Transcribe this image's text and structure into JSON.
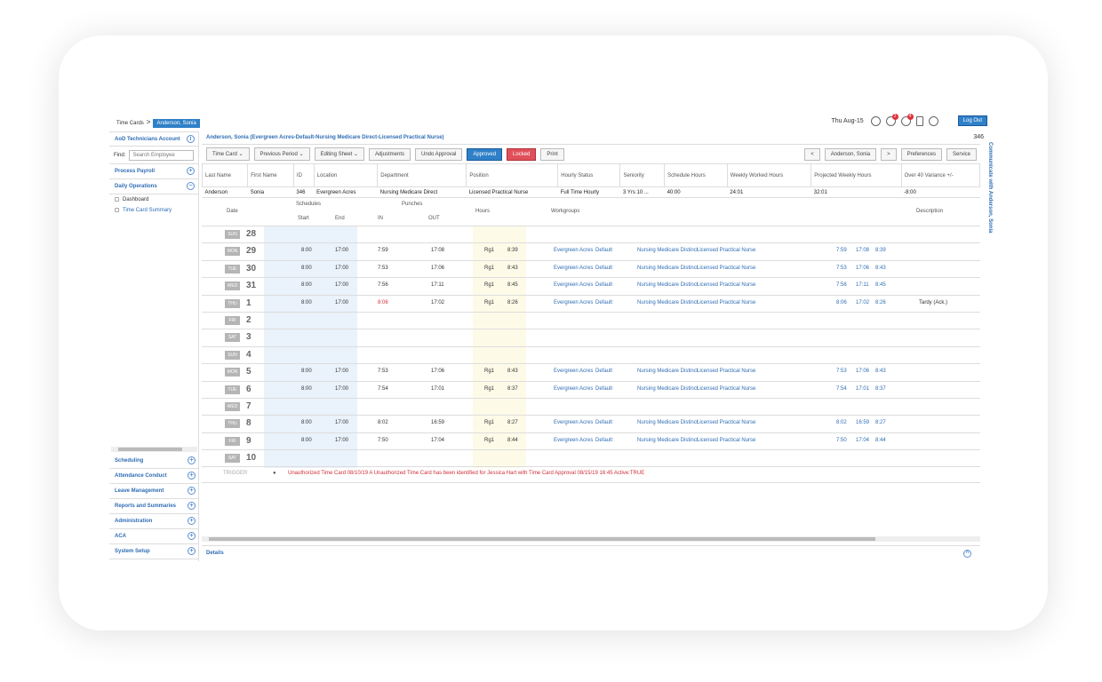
{
  "breadcrumb": {
    "root": "Time Cards",
    "sep": ">",
    "current": "Anderson, Sonia"
  },
  "topbar": {
    "date": "Thu Aug-15",
    "notif_badge1": "2",
    "notif_badge2": "4",
    "logout": "Log Out"
  },
  "sidebar": {
    "account": "AoD Technicians Account",
    "find_label": "Find:",
    "find_placeholder": "Search Employee",
    "sections": [
      "Process Payroll",
      "Daily Operations"
    ],
    "items": [
      "Dashboard",
      "Time Card Summary"
    ],
    "lower": [
      "Scheduling",
      "Attendance Conduct",
      "Leave Management",
      "Reports and Summaries",
      "Administration",
      "ACA",
      "System Setup"
    ]
  },
  "main": {
    "title": "Anderson, Sonia (Evergreen Acres-Default-Nursing Medicare Direct-Licensed Practical Nurse)",
    "count": "346",
    "toolbar": [
      "Time Card",
      "Previous Period",
      "Editing Sheet",
      "Adjustments",
      "Undo Approval",
      "Approved",
      "Locked",
      "Print"
    ],
    "toolbar_right": [
      "<",
      "Anderson, Sonia",
      ">",
      "Preferences",
      "Service"
    ],
    "info_headers": [
      "Last Name",
      "First Name",
      "ID",
      "Location",
      "Department",
      "Position",
      "Hourly Status",
      "Seniority",
      "Schedule Hours",
      "Weekly Worked Hours",
      "Projected Weekly Hours",
      "Over 40 Variance +/-"
    ],
    "info_values": [
      "Anderson",
      "Sonia",
      "346",
      "Evergreen Acres",
      "Nursing Medicare Direct",
      "Licensed Practical Nurse",
      "Full Time Hourly",
      "3 Yrs 10 ...",
      "40:00",
      "24:01",
      "32:01",
      "-8:00"
    ],
    "grid_headers": {
      "date": "Date",
      "schedules": "Schedules",
      "start": "Start",
      "end": "End",
      "punches": "Punches",
      "in": "IN",
      "out": "OUT",
      "hours": "Hours",
      "workgroups": "Workgroups",
      "description": "Description"
    },
    "rows": [
      {
        "day": "SUN",
        "num": "28"
      },
      {
        "day": "MON",
        "num": "29",
        "start": "8:00",
        "end": "17:00",
        "in": "7:59",
        "out": "17:08",
        "code": "Rg1",
        "hours": "8:39",
        "loc": "Evergreen Acres",
        "grp": "Default",
        "dept": "Nursing Medicare Distinct",
        "pos": "Licensed Practical Nurse",
        "p1": "7:59",
        "p2": "17:08",
        "p3": "8:39"
      },
      {
        "day": "TUE",
        "num": "30",
        "start": "8:00",
        "end": "17:00",
        "in": "7:53",
        "out": "17:06",
        "code": "Rg1",
        "hours": "8:43",
        "loc": "Evergreen Acres",
        "grp": "Default",
        "dept": "Nursing Medicare Distinct",
        "pos": "Licensed Practical Nurse",
        "p1": "7:53",
        "p2": "17:06",
        "p3": "8:43"
      },
      {
        "day": "WED",
        "num": "31",
        "start": "8:00",
        "end": "17:00",
        "in": "7:56",
        "out": "17:11",
        "code": "Rg1",
        "hours": "8:45",
        "loc": "Evergreen Acres",
        "grp": "Default",
        "dept": "Nursing Medicare Distinct",
        "pos": "Licensed Practical Nurse",
        "p1": "7:56",
        "p2": "17:11",
        "p3": "8:45"
      },
      {
        "day": "THU",
        "num": "1",
        "start": "8:00",
        "end": "17:00",
        "in": "8:06",
        "out": "17:02",
        "code": "Rg1",
        "hours": "8:26",
        "loc": "Evergreen Acres",
        "grp": "Default",
        "dept": "Nursing Medicare Distinct",
        "pos": "Licensed Practical Nurse",
        "p1": "8:06",
        "p2": "17:02",
        "p3": "8:26",
        "desc": "Tardy (Ack.)"
      },
      {
        "day": "FRI",
        "num": "2"
      },
      {
        "day": "SAT",
        "num": "3"
      },
      {
        "day": "SUN",
        "num": "4"
      },
      {
        "day": "MON",
        "num": "5",
        "start": "8:00",
        "end": "17:00",
        "in": "7:53",
        "out": "17:06",
        "code": "Rg1",
        "hours": "8:43",
        "loc": "Evergreen Acres",
        "grp": "Default",
        "dept": "Nursing Medicare Distinct",
        "pos": "Licensed Practical Nurse",
        "p1": "7:53",
        "p2": "17:06",
        "p3": "8:43"
      },
      {
        "day": "TUE",
        "num": "6",
        "start": "8:00",
        "end": "17:00",
        "in": "7:54",
        "out": "17:01",
        "code": "Rg1",
        "hours": "8:37",
        "loc": "Evergreen Acres",
        "grp": "Default",
        "dept": "Nursing Medicare Distinct",
        "pos": "Licensed Practical Nurse",
        "p1": "7:54",
        "p2": "17:01",
        "p3": "8:37"
      },
      {
        "day": "WED",
        "num": "7"
      },
      {
        "day": "THU",
        "num": "8",
        "start": "8:00",
        "end": "17:00",
        "in": "8:02",
        "out": "16:59",
        "code": "Rg1",
        "hours": "8:27",
        "loc": "Evergreen Acres",
        "grp": "Default",
        "dept": "Nursing Medicare Distinct",
        "pos": "Licensed Practical Nurse",
        "p1": "8:02",
        "p2": "16:59",
        "p3": "8:27"
      },
      {
        "day": "FRI",
        "num": "9",
        "start": "8:00",
        "end": "17:00",
        "in": "7:50",
        "out": "17:04",
        "code": "Rg1",
        "hours": "8:44",
        "loc": "Evergreen Acres",
        "grp": "Default",
        "dept": "Nursing Medicare Distinct",
        "pos": "Licensed Practical Nurse",
        "p1": "7:50",
        "p2": "17:04",
        "p3": "8:44"
      },
      {
        "day": "SAT",
        "num": "10"
      }
    ],
    "trigger_label": "TRIGGER",
    "trigger_msg": "Unauthorized Time Card 08/10/19 A Unauthorized Time Card has been identified for Jessica Hart with Time Card Approval 08/15/19 16:45 Active:TRUE",
    "details": "Details",
    "comm": "Communicate with Anderson, Sonia"
  }
}
